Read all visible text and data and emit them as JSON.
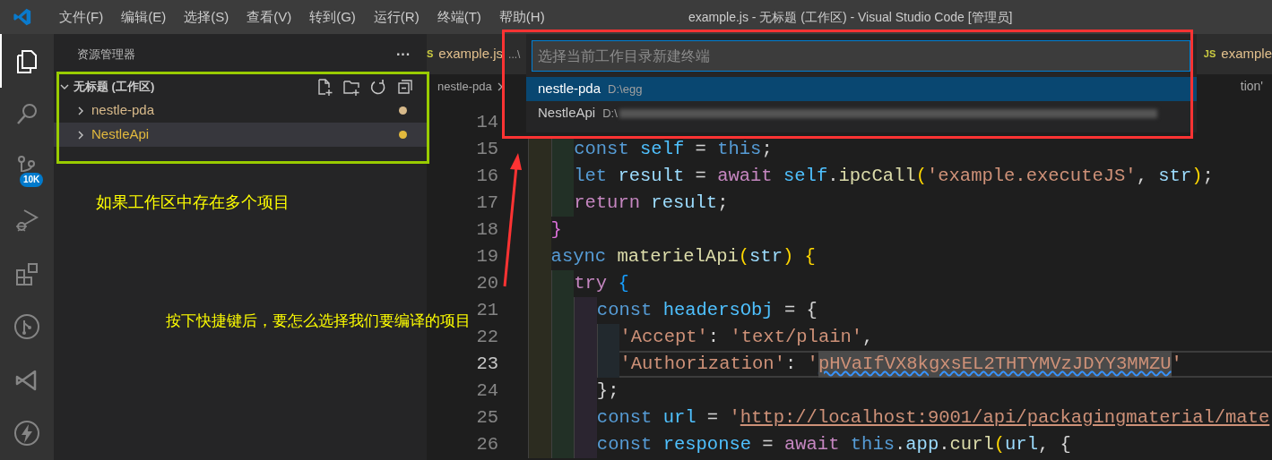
{
  "title_bar": {
    "menu": [
      "文件(F)",
      "编辑(E)",
      "选择(S)",
      "查看(V)",
      "转到(G)",
      "运行(R)",
      "终端(T)",
      "帮助(H)"
    ],
    "title": "example.js - 无标题 (工作区) - Visual Studio Code [管理员]"
  },
  "activity_bar": [
    {
      "kind": "explorer",
      "selected": true
    },
    {
      "kind": "search",
      "selected": false
    },
    {
      "kind": "source-control",
      "selected": false,
      "badge": "10K"
    },
    {
      "kind": "run-debug",
      "selected": false
    },
    {
      "kind": "extensions",
      "selected": false
    },
    {
      "kind": "git-graph",
      "selected": false
    },
    {
      "kind": "visual-studio",
      "selected": false
    },
    {
      "kind": "lightning",
      "selected": false
    }
  ],
  "sidebar": {
    "title": "资源管理器",
    "more": "···",
    "workspace": {
      "label": "无标题 (工作区)",
      "expanded": true,
      "children": [
        {
          "label": "nestle-pda",
          "expanded": false,
          "selected": false,
          "color": "#d7b98a"
        },
        {
          "label": "NestleApi",
          "expanded": false,
          "selected": true,
          "color": "#e2b93d"
        }
      ]
    }
  },
  "editor": {
    "tabs": [
      {
        "icon": "S",
        "label": "example.js",
        "description": "...\\"
      },
      {
        "icon": "JS",
        "label": "example"
      }
    ],
    "breadcrumb": "nestle-pda",
    "breadcrumb_end": "tion'",
    "lines": [
      {
        "number": "14",
        "current": false
      },
      {
        "number": "15",
        "current": false,
        "tokens": [
          {
            "text": "    const",
            "kind": "keyword"
          },
          {
            "text": " self",
            "kind": "constant"
          },
          {
            "text": " = ",
            "kind": "plain"
          },
          {
            "text": "this",
            "kind": "keyword"
          },
          {
            "text": ";",
            "kind": "plain"
          }
        ]
      },
      {
        "number": "16",
        "current": false,
        "tokens": [
          {
            "text": "    let",
            "kind": "keyword"
          },
          {
            "text": " result",
            "kind": "variable"
          },
          {
            "text": " = ",
            "kind": "plain"
          },
          {
            "text": "await",
            "kind": "control"
          },
          {
            "text": " self",
            "kind": "constant"
          },
          {
            "text": ".",
            "kind": "plain"
          },
          {
            "text": "ipcCall",
            "kind": "function"
          },
          {
            "text": "(",
            "kind": "bracket"
          },
          {
            "text": "'example.executeJS'",
            "kind": "string"
          },
          {
            "text": ", ",
            "kind": "plain"
          },
          {
            "text": "str",
            "kind": "variable"
          },
          {
            "text": ")",
            "kind": "bracket"
          },
          {
            "text": ";",
            "kind": "plain"
          }
        ]
      },
      {
        "number": "17",
        "current": false,
        "tokens": [
          {
            "text": "    return",
            "kind": "control"
          },
          {
            "text": " result",
            "kind": "variable"
          },
          {
            "text": ";",
            "kind": "plain"
          }
        ]
      },
      {
        "number": "18",
        "current": false,
        "tokens": [
          {
            "text": "  }",
            "kind": "bracket2"
          }
        ]
      },
      {
        "number": "19",
        "current": false,
        "tokens": [
          {
            "text": "  async",
            "kind": "keyword"
          },
          {
            "text": " materielApi",
            "kind": "function"
          },
          {
            "text": "(",
            "kind": "bracket"
          },
          {
            "text": "str",
            "kind": "variable"
          },
          {
            "text": ")",
            "kind": "bracket"
          },
          {
            "text": " {",
            "kind": "bracket"
          }
        ]
      },
      {
        "number": "20",
        "current": false,
        "tokens": [
          {
            "text": "    try",
            "kind": "control"
          },
          {
            "text": " {",
            "kind": "bracket3"
          }
        ]
      },
      {
        "number": "21",
        "current": false,
        "tokens": [
          {
            "text": "      const",
            "kind": "keyword"
          },
          {
            "text": " headersObj",
            "kind": "constant"
          },
          {
            "text": " = {",
            "kind": "plain"
          }
        ]
      },
      {
        "number": "22",
        "current": false,
        "tokens": [
          {
            "text": "        'Accept'",
            "kind": "string"
          },
          {
            "text": ": ",
            "kind": "plain"
          },
          {
            "text": "'text/plain'",
            "kind": "string"
          },
          {
            "text": ",",
            "kind": "plain"
          }
        ]
      },
      {
        "number": "23",
        "current": true,
        "tokens": [
          {
            "text": "        'Authorization'",
            "kind": "string"
          },
          {
            "text": ": ",
            "kind": "plain"
          },
          {
            "text": "'",
            "kind": "string"
          },
          {
            "text": "pHVaIfVX8kgxsEL2THTYMVzJDYY3MMZU",
            "kind": "highlight"
          },
          {
            "text": "'",
            "kind": "string"
          }
        ]
      },
      {
        "number": "24",
        "current": false,
        "tokens": [
          {
            "text": "      };",
            "kind": "plain"
          }
        ]
      },
      {
        "number": "25",
        "current": false,
        "tokens": [
          {
            "text": "      const",
            "kind": "keyword"
          },
          {
            "text": " url",
            "kind": "constant"
          },
          {
            "text": " = ",
            "kind": "plain"
          },
          {
            "text": "'",
            "kind": "string"
          },
          {
            "text": "http://localhost:9001/api/packagingmaterial/mate",
            "kind": "link"
          }
        ]
      },
      {
        "number": "26",
        "current": false,
        "tokens": [
          {
            "text": "      const",
            "kind": "keyword"
          },
          {
            "text": " response",
            "kind": "constant"
          },
          {
            "text": " = ",
            "kind": "plain"
          },
          {
            "text": "await",
            "kind": "control"
          },
          {
            "text": " this",
            "kind": "keyword"
          },
          {
            "text": ".",
            "kind": "plain"
          },
          {
            "text": "app",
            "kind": "variable"
          },
          {
            "text": ".",
            "kind": "plain"
          },
          {
            "text": "curl",
            "kind": "function"
          },
          {
            "text": "(",
            "kind": "bracket"
          },
          {
            "text": "url",
            "kind": "variable"
          },
          {
            "text": ", {",
            "kind": "plain"
          }
        ]
      }
    ]
  },
  "quick_pick": {
    "placeholder": "选择当前工作目录新建终端",
    "items": [
      {
        "label": "nestle-pda",
        "description": "D:\\egg",
        "redacted": false,
        "selected": true
      },
      {
        "label": "NestleApi",
        "description": "D:\\",
        "redacted": true,
        "selected": false
      }
    ]
  },
  "annotations": [
    {
      "text": "如果工作区中存在多个项目"
    },
    {
      "text": "按下快捷键后，要怎么选择我们要编译的项目"
    }
  ]
}
